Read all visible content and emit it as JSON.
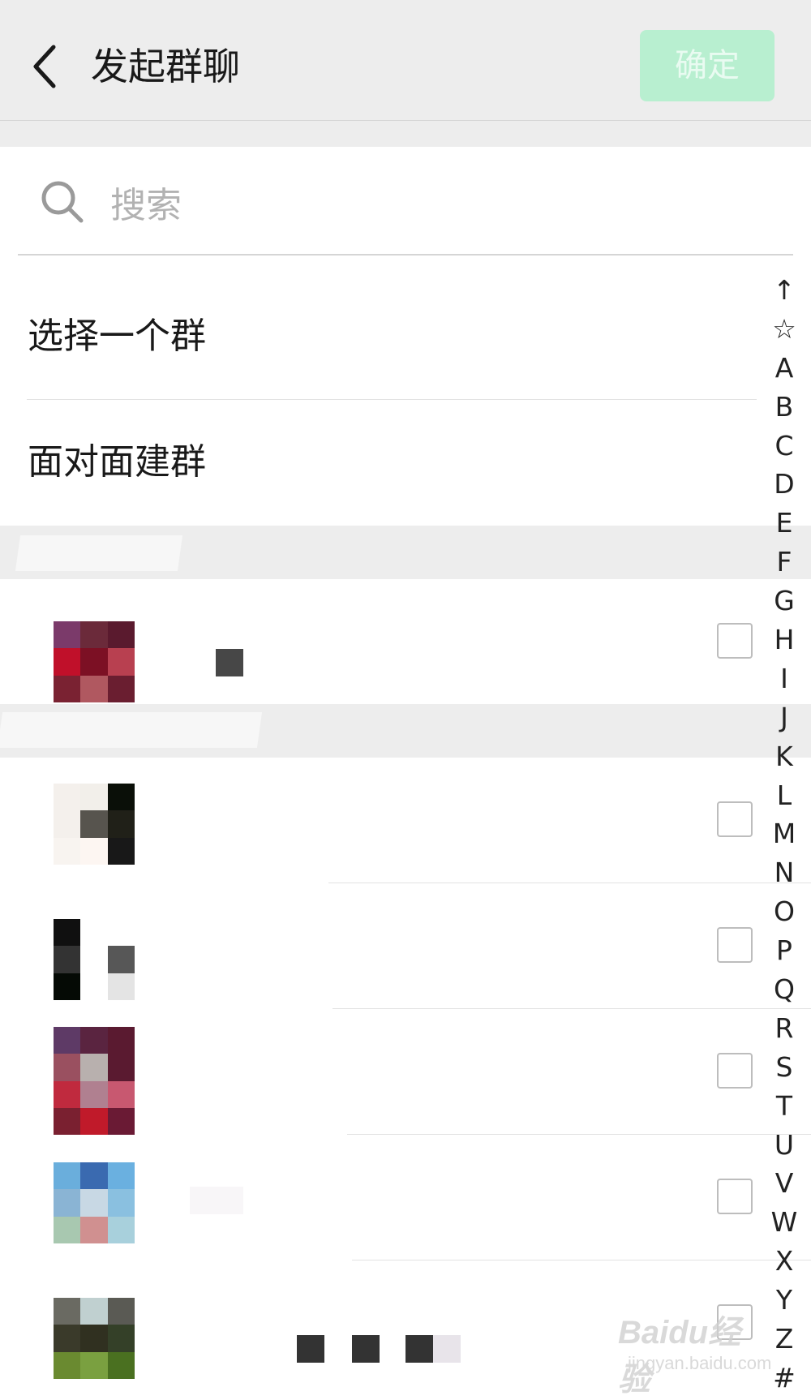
{
  "header": {
    "title": "发起群聊",
    "confirm_label": "确定",
    "confirm_color": "#b8efd0"
  },
  "search": {
    "placeholder": "搜索"
  },
  "options": [
    {
      "label": "选择一个群"
    },
    {
      "label": "面对面建群"
    }
  ],
  "index_bar": [
    "↑",
    "☆",
    "A",
    "B",
    "C",
    "D",
    "E",
    "F",
    "G",
    "H",
    "I",
    "J",
    "K",
    "L",
    "M",
    "N",
    "O",
    "P",
    "Q",
    "R",
    "S",
    "T",
    "U",
    "V",
    "W",
    "X",
    "Y",
    "Z",
    "#"
  ],
  "contacts": [
    {
      "avatar_colors": [
        "#7b3a6a",
        "#6b2a3a",
        "#5a1a2e",
        "#c0102a",
        "#7c1024",
        "#b84050",
        "#7a2232",
        "#b05860",
        "#6a1e30"
      ]
    },
    {
      "avatar_colors": [
        "#f4f0ec",
        "#f2efea",
        "#0a0f08",
        "#f4f0ec",
        "#57544e",
        "#202018",
        "#f8f4f0",
        "#fdf6f2",
        "#181818"
      ]
    },
    {
      "avatar_colors": [
        "#101010",
        "#ffffff",
        "#ffffff",
        "#333333",
        "#ffffff",
        "#575757",
        "#050a05",
        "#ffffff",
        "#e4e4e4"
      ]
    },
    {
      "avatar_colors": [
        "#5e3a66",
        "#5a2440",
        "#5a1a30",
        "#9a5060",
        "#b8b0ae",
        "#5a1a30",
        "#c02a3e",
        "#b08090",
        "#c85870",
        "#7a2030",
        "#c01a2a",
        "#6a1a34"
      ]
    },
    {
      "avatar_colors": [
        "#6aaedc",
        "#3a6ab0",
        "#6ab0e0",
        "#8ab4d4",
        "#c8d8e4",
        "#8ac0e0",
        "#a8c8b0",
        "#d09090",
        "#a8d0dc"
      ]
    },
    {
      "avatar_colors": [
        "#6a6a62",
        "#c0d0d0",
        "#5a5a54",
        "#3a3a2a",
        "#303020",
        "#344028",
        "#6a8a30",
        "#7aa040",
        "#4a7020"
      ]
    }
  ],
  "watermark": {
    "logo": "Baidu经验",
    "sub": "jingyan.baidu.com"
  }
}
